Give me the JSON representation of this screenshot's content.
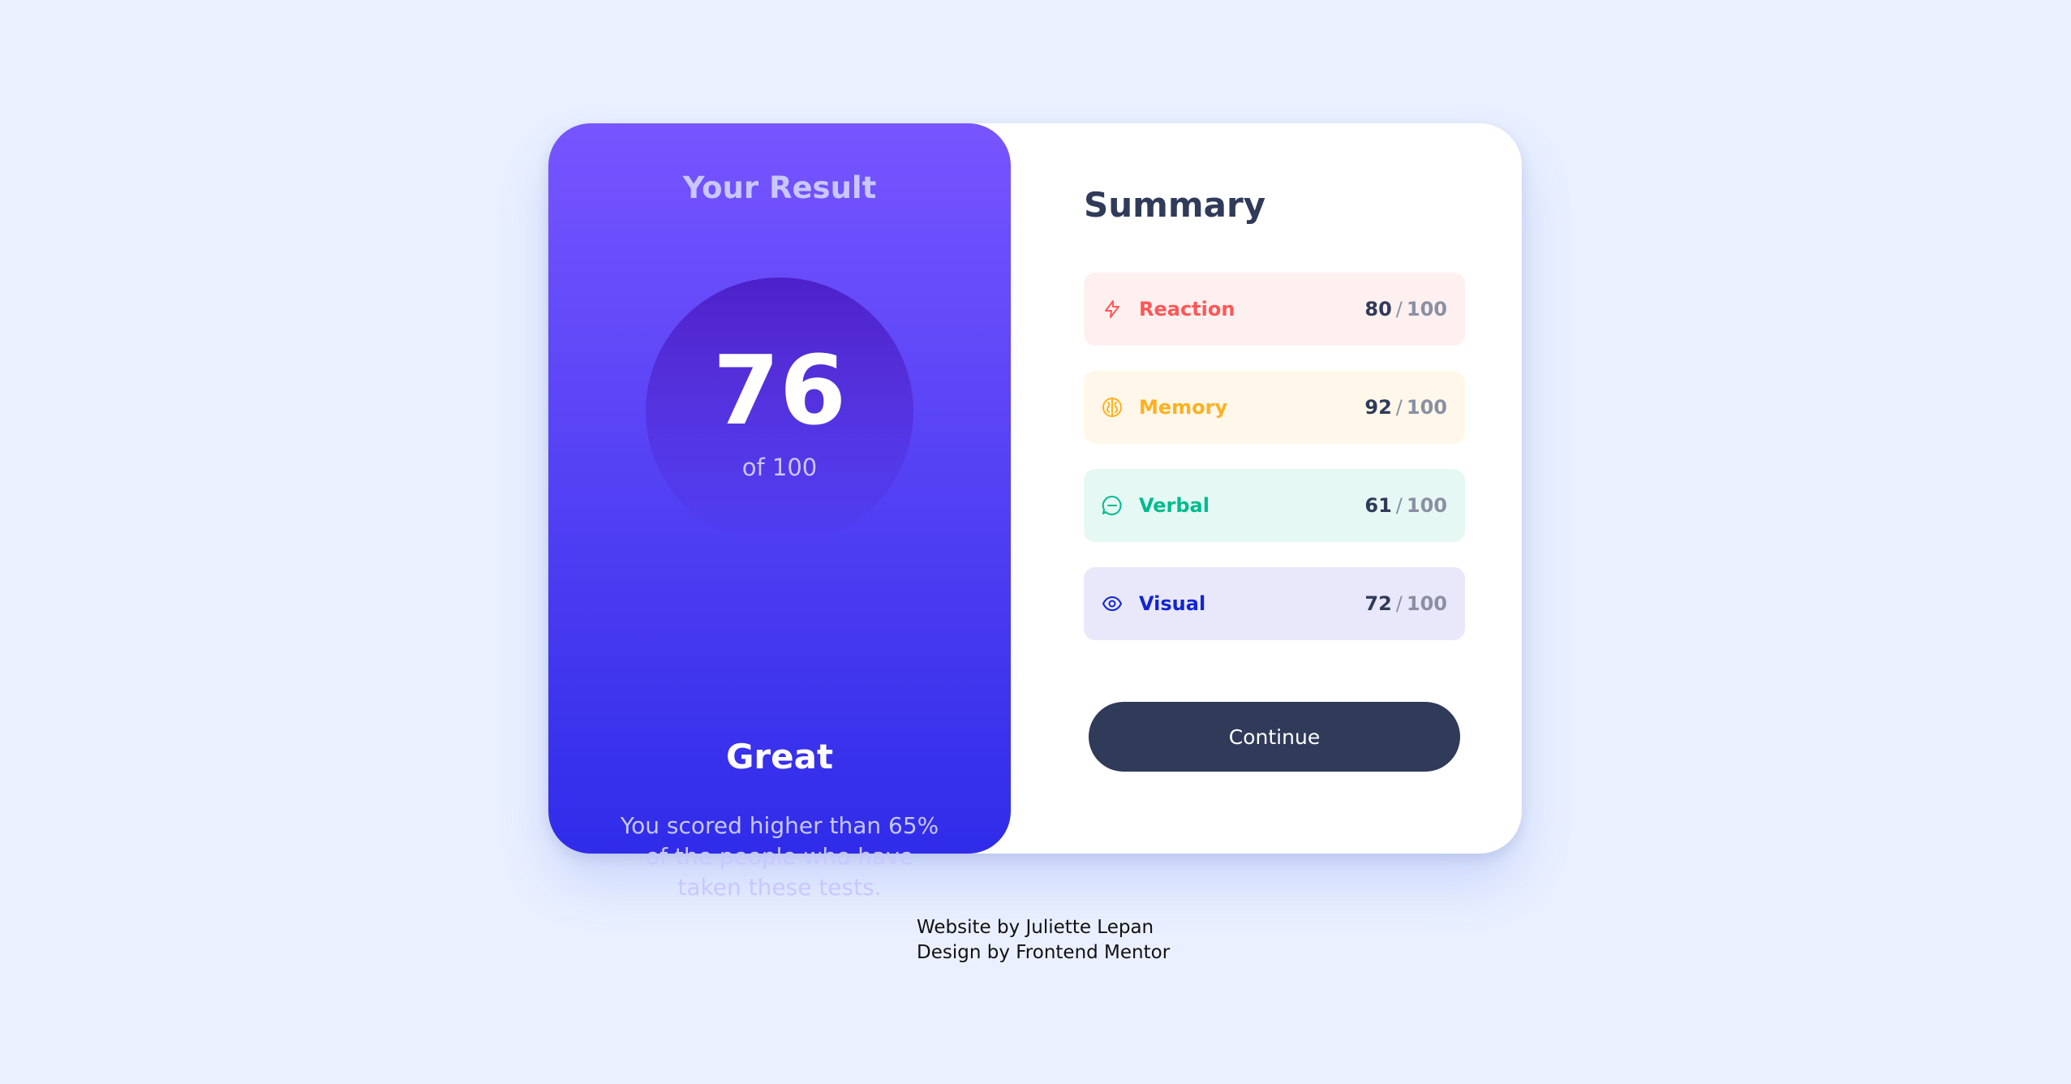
{
  "result": {
    "title": "Your Result",
    "score": "76",
    "total": "of 100",
    "rating": "Great",
    "description": "You scored higher than 65% of the people who have taken these tests."
  },
  "summary": {
    "title": "Summary",
    "items": [
      {
        "label": "Reaction",
        "score": "80",
        "separator": "/",
        "max": "100",
        "icon": "lightning-icon",
        "color": "#ff5757",
        "background": "#fff0f0"
      },
      {
        "label": "Memory",
        "score": "92",
        "separator": "/",
        "max": "100",
        "icon": "brain-icon",
        "color": "#ffb01f",
        "background": "#fff8ea"
      },
      {
        "label": "Verbal",
        "score": "61",
        "separator": "/",
        "max": "100",
        "icon": "chat-bubble-icon",
        "color": "#00bb8f",
        "background": "#e6f8f4"
      },
      {
        "label": "Visual",
        "score": "72",
        "separator": "/",
        "max": "100",
        "icon": "eye-icon",
        "color": "#1125d4",
        "background": "#e9e8fb"
      }
    ],
    "continue_label": "Continue"
  },
  "footer": {
    "line1": "Website by Juliette Lepan",
    "line2": "Design by Frontend Mentor"
  }
}
